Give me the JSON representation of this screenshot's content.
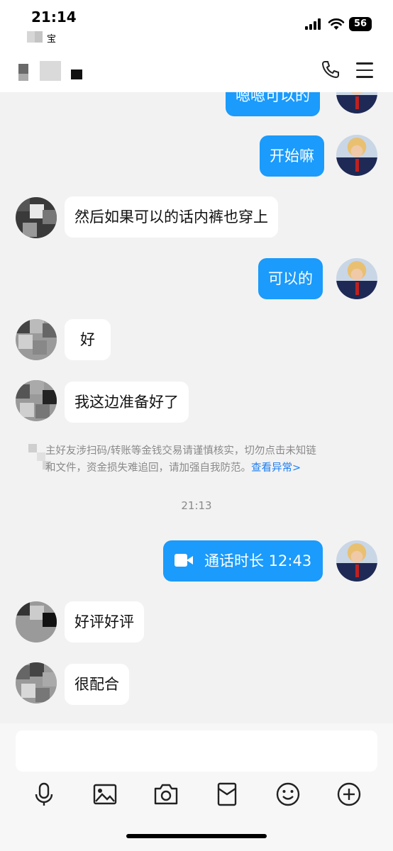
{
  "status_bar": {
    "time": "21:14",
    "back_label": "宝",
    "battery": "56"
  },
  "icons": {
    "call": "phone-icon",
    "more": "menu-icon",
    "video_call": "video-camera-icon",
    "toolbar": [
      "microphone-icon",
      "image-icon",
      "camera-icon",
      "red-packet-icon",
      "emoji-icon",
      "plus-icon"
    ]
  },
  "colors": {
    "outgoing_bubble": "#1b9bfb",
    "incoming_bubble": "#ffffff",
    "link": "#1b7ef3"
  },
  "messages": [
    {
      "direction": "out",
      "text": "嗯嗯可以的"
    },
    {
      "direction": "out",
      "text": "开始嘛"
    },
    {
      "direction": "in",
      "text": "然后如果可以的话内裤也穿上"
    },
    {
      "direction": "out",
      "text": "可以的"
    },
    {
      "direction": "in",
      "text": "好"
    },
    {
      "direction": "in",
      "text": "我这边准备好了"
    }
  ],
  "notice": {
    "line1": "主好友涉扫码/转账等金钱交易请谨慎核实，切勿点击未知链",
    "line2": "和文件，资金损失难追回，请加强自我防范。",
    "link": "查看异常>"
  },
  "timestamp": "21:13",
  "call_record": {
    "label": "通话时长 12:43"
  },
  "messages_after": [
    {
      "direction": "in",
      "text": "好评好评"
    },
    {
      "direction": "in",
      "text": "很配合"
    }
  ],
  "input": {
    "placeholder": ""
  }
}
